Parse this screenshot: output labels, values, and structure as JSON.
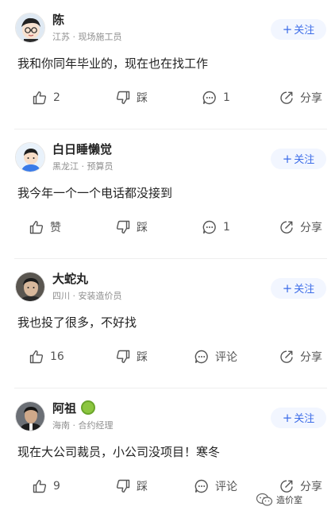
{
  "posts": [
    {
      "name": "陈",
      "meta": "江苏 · 现场施工员",
      "follow": "关注",
      "content": "我和你同年毕业的，现在也在找工作",
      "like": "2",
      "dislike": "踩",
      "comment": "1",
      "share": "分享",
      "avatar": "cartoon-avatar-glasses"
    },
    {
      "name": "白日睡懒觉",
      "meta": "黑龙江 · 预算员",
      "follow": "关注",
      "content": "我今年一个一个电话都没接到",
      "like": "赞",
      "dislike": "踩",
      "comment": "1",
      "share": "分享",
      "avatar": "cartoon-avatar-blue"
    },
    {
      "name": "大蛇丸",
      "meta": "四川 · 安装造价员",
      "follow": "关注",
      "content": "我也投了很多，不好找",
      "like": "16",
      "dislike": "踩",
      "comment": "评论",
      "share": "分享",
      "avatar": "photo-avatar"
    },
    {
      "name": "阿祖",
      "meta": "海南 · 合约经理",
      "follow": "关注",
      "content": "现在大公司裁员，小公司没项目！寒冬",
      "like": "9",
      "dislike": "踩",
      "comment": "评论",
      "share": "分享",
      "avatar": "photo-avatar",
      "badge": "verified-badge-icon"
    }
  ],
  "watermark": {
    "text": "造价室"
  },
  "colors": {
    "accent": "#3d6de8",
    "follow_bg": "#f2f6ff",
    "muted": "#8e8e8e"
  }
}
